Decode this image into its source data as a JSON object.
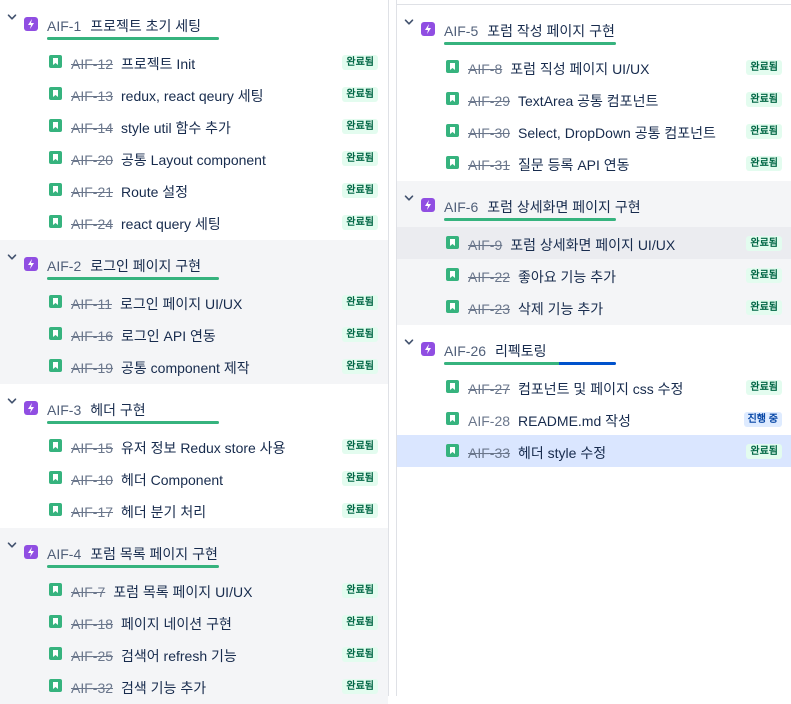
{
  "colors": {
    "epic_icon": "#904ee2",
    "story_icon": "#36b37e",
    "progress_done": "#36b37e",
    "progress_in_progress": "#0052cc",
    "badge_done_bg": "#e3fcef",
    "badge_done_text": "#006644",
    "badge_in_progress_bg": "#deebff",
    "badge_in_progress_text": "#0747a6",
    "selected_row": "#dae6ff"
  },
  "icons": {
    "epic": "lightning-bolt-icon",
    "story": "bookmark-icon",
    "expand": "chevron-down-icon"
  },
  "left_column": [
    {
      "key": "AIF-1",
      "title": "프로젝트 초기 세팅",
      "progress": {
        "done": 1.0,
        "in_progress": 0.0
      },
      "issues": [
        {
          "key": "AIF-12",
          "title": "프로젝트 Init",
          "status": "완료됨",
          "done": true
        },
        {
          "key": "AIF-13",
          "title": "redux, react qeury 세팅",
          "status": "완료됨",
          "done": true
        },
        {
          "key": "AIF-14",
          "title": "style util 함수 추가",
          "status": "완료됨",
          "done": true
        },
        {
          "key": "AIF-20",
          "title": "공통 Layout component",
          "status": "완료됨",
          "done": true
        },
        {
          "key": "AIF-21",
          "title": "Route 설정",
          "status": "완료됨",
          "done": true
        },
        {
          "key": "AIF-24",
          "title": "react query 세팅",
          "status": "완료됨",
          "done": true
        }
      ]
    },
    {
      "key": "AIF-2",
      "title": "로그인 페이지 구현",
      "progress": {
        "done": 1.0,
        "in_progress": 0.0
      },
      "issues": [
        {
          "key": "AIF-11",
          "title": "로그인 페이지 UI/UX",
          "status": "완료됨",
          "done": true
        },
        {
          "key": "AIF-16",
          "title": "로그인 API 연동",
          "status": "완료됨",
          "done": true
        },
        {
          "key": "AIF-19",
          "title": "공통 component 제작",
          "status": "완료됨",
          "done": true
        }
      ]
    },
    {
      "key": "AIF-3",
      "title": "헤더 구현",
      "progress": {
        "done": 1.0,
        "in_progress": 0.0
      },
      "issues": [
        {
          "key": "AIF-15",
          "title": "유저 정보 Redux store 사용",
          "status": "완료됨",
          "done": true
        },
        {
          "key": "AIF-10",
          "title": "헤더 Component",
          "status": "완료됨",
          "done": true
        },
        {
          "key": "AIF-17",
          "title": "헤더 분기 처리",
          "status": "완료됨",
          "done": true
        }
      ]
    },
    {
      "key": "AIF-4",
      "title": "포럼 목록 페이지 구현",
      "progress": {
        "done": 1.0,
        "in_progress": 0.0
      },
      "issues": [
        {
          "key": "AIF-7",
          "title": "포럼 목록 페이지 UI/UX",
          "status": "완료됨",
          "done": true
        },
        {
          "key": "AIF-18",
          "title": "페이지 네이션 구현",
          "status": "완료됨",
          "done": true
        },
        {
          "key": "AIF-25",
          "title": "검색어 refresh 기능",
          "status": "완료됨",
          "done": true
        },
        {
          "key": "AIF-32",
          "title": "검색 기능 추가",
          "status": "완료됨",
          "done": true
        }
      ]
    }
  ],
  "right_column": [
    {
      "key": "AIF-5",
      "title": "포럼 작성 페이지 구현",
      "progress": {
        "done": 1.0,
        "in_progress": 0.0
      },
      "issues": [
        {
          "key": "AIF-8",
          "title": "포럼 직성 페이지 UI/UX",
          "status": "완료됨",
          "done": true
        },
        {
          "key": "AIF-29",
          "title": "TextArea 공통 컴포넌트",
          "status": "완료됨",
          "done": true
        },
        {
          "key": "AIF-30",
          "title": "Select, DropDown 공통 컴포넌트",
          "status": "완료됨",
          "done": true
        },
        {
          "key": "AIF-31",
          "title": "질문 등록 API 연동",
          "status": "완료됨",
          "done": true
        }
      ]
    },
    {
      "key": "AIF-6",
      "title": "포럼 상세화면 페이지 구현",
      "progress": {
        "done": 1.0,
        "in_progress": 0.0
      },
      "issues": [
        {
          "key": "AIF-9",
          "title": "포럼 상세화면 페이지 UI/UX",
          "status": "완료됨",
          "done": true,
          "hovered": true
        },
        {
          "key": "AIF-22",
          "title": "좋아요 기능 추가",
          "status": "완료됨",
          "done": true
        },
        {
          "key": "AIF-23",
          "title": "삭제 기능 추가",
          "status": "완료됨",
          "done": true
        }
      ]
    },
    {
      "key": "AIF-26",
      "title": "리펙토링",
      "progress": {
        "done": 0.67,
        "in_progress": 0.33
      },
      "issues": [
        {
          "key": "AIF-27",
          "title": "컴포넌트 및 페이지 css 수정",
          "status": "완료됨",
          "done": true
        },
        {
          "key": "AIF-28",
          "title": "README.md 작성",
          "status": "진행 중",
          "done": false
        },
        {
          "key": "AIF-33",
          "title": "헤더 style 수정",
          "status": "완료됨",
          "done": true,
          "selected": true
        }
      ]
    }
  ]
}
